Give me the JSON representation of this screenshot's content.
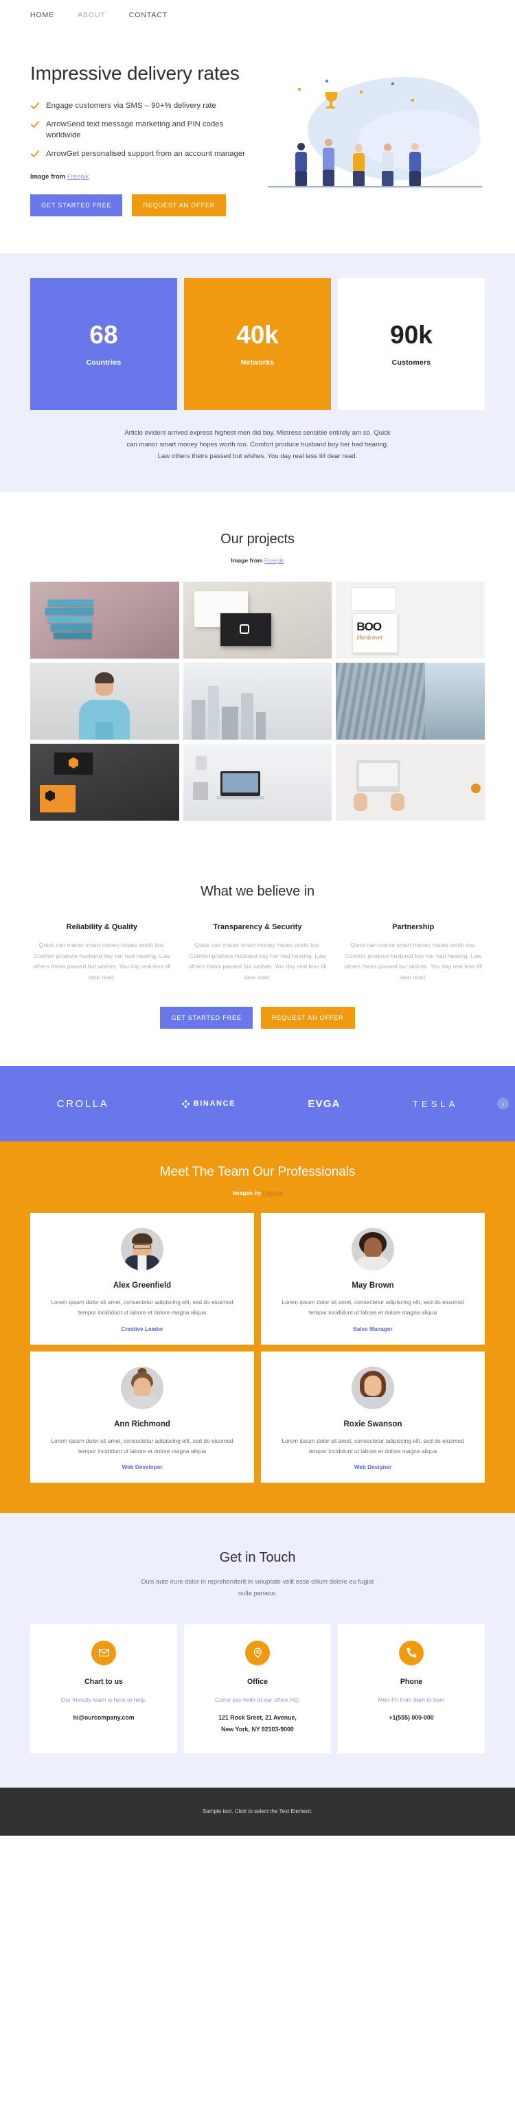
{
  "nav": {
    "items": [
      {
        "label": "HOME",
        "muted": false
      },
      {
        "label": "ABOUT",
        "muted": true
      },
      {
        "label": "CONTACT",
        "muted": false
      }
    ]
  },
  "hero": {
    "title": "Impressive delivery rates",
    "bullets": [
      "Engage customers via SMS – 90+% delivery rate",
      "ArrowSend text message marketing and PIN codes worldwide",
      "ArrowGet personalised support from an account manager"
    ],
    "credit_prefix": "Image from ",
    "credit_link": "Freepik",
    "primary_button": "GET STARTED FREE",
    "secondary_button": "REQUEST AN OFFER"
  },
  "stats": {
    "items": [
      {
        "number": "68",
        "label": "Countries",
        "style": "blue"
      },
      {
        "number": "40k",
        "label": "Networks",
        "style": "orange"
      },
      {
        "number": "90k",
        "label": "Customers",
        "style": "white"
      }
    ],
    "note": "Article evident arrived express highest men did boy. Mistress sensible entirely am so. Quick can manor smart money hopes worth too. Comfort produce husband boy her had hearing. Law others theirs passed but wishes. You day real less till dear read."
  },
  "projects": {
    "title": "Our projects",
    "credit_prefix": "Image from ",
    "credit_link": "Freepik",
    "tiles": [
      {
        "name": "stacked-books-mockup"
      },
      {
        "name": "business-card-mockup"
      },
      {
        "name": "book-cover-mockup"
      },
      {
        "name": "portrait-man-blue-shirt"
      },
      {
        "name": "city-skyline-buildings"
      },
      {
        "name": "modern-glass-building"
      },
      {
        "name": "dark-branding-stationery"
      },
      {
        "name": "desk-laptop-lamp"
      },
      {
        "name": "hands-typing-laptop-desk"
      }
    ]
  },
  "believe": {
    "title": "What we believe in",
    "columns": [
      {
        "heading": "Reliability & Quality",
        "body": "Quick can manor smart money hopes worth too. Comfort produce husband boy her had hearing. Law others theirs passed but wishes. You day real less till dear read."
      },
      {
        "heading": "Transparency & Security",
        "body": "Quick can manor smart money hopes worth too. Comfort produce husband boy her had hearing. Law others theirs passed but wishes. You day real less till dear read."
      },
      {
        "heading": "Partnership",
        "body": "Quick can manor smart money hopes worth too. Comfort produce husband boy her had hearing. Law others theirs passed but wishes. You day real less till dear read."
      }
    ],
    "primary_button": "GET STARTED FREE",
    "secondary_button": "REQUEST AN OFFER"
  },
  "logos": {
    "items": [
      "CROLLA",
      "BINANCE",
      "EVGA",
      "TESLA"
    ],
    "next_arrow": "›"
  },
  "team": {
    "title": "Meet The Team Our Professionals",
    "credit_prefix": "Images by ",
    "credit_link": "Freepik",
    "members": [
      {
        "name": "Alex Greenfield",
        "bio": "Lorem ipsum dolor sit amet, consectetur adipiscing elit, sed do eiusmod tempor incididunt ut labore et dolore magna aliqua",
        "role": "Creative Leader"
      },
      {
        "name": "May Brown",
        "bio": "Lorem ipsum dolor sit amet, consectetur adipiscing elit, sed do eiusmod tempor incididunt ut labore et dolore magna aliqua",
        "role": "Sales Manager"
      },
      {
        "name": "Ann Richmond",
        "bio": "Lorem ipsum dolor sit amet, consectetur adipiscing elit, sed do eiusmod tempor incididunt ut labore et dolore magna aliqua",
        "role": "Web Developer"
      },
      {
        "name": "Roxie Swanson",
        "bio": "Lorem ipsum dolor sit amet, consectetur adipiscing elit, sed do eiusmod tempor incididunt ut labore et dolore magna aliqua",
        "role": "Web Designer"
      }
    ]
  },
  "contact": {
    "title": "Get in Touch",
    "lead": "Duis aute irure dolor in reprehenderit in voluptate velit esse cillum dolore eu fugiat nulla pariatur.",
    "cards": [
      {
        "icon": "envelope-icon",
        "heading": "Chart to us",
        "sub": "Our friendly team is here to help.",
        "line1": "hi@ourcompany.com",
        "line2": ""
      },
      {
        "icon": "map-pin-icon",
        "heading": "Office",
        "sub": "Come say hello at our office HQ.",
        "line1": "121 Rock Sreet, 21 Avenue,",
        "line2": "New York, NY 92103-9000"
      },
      {
        "icon": "phone-icon",
        "heading": "Phone",
        "sub": "Mon-Fri from 8am to 5am",
        "line1": "+1(555) 000-000",
        "line2": ""
      }
    ]
  },
  "footer": {
    "text": "Sample text. Click to select the Text Element."
  },
  "colors": {
    "blue": "#6a77eb",
    "orange": "#f09a12",
    "lavender_bg": "#edeffc",
    "footer_bg": "#323232",
    "link_blue": "#8f9bd8"
  }
}
